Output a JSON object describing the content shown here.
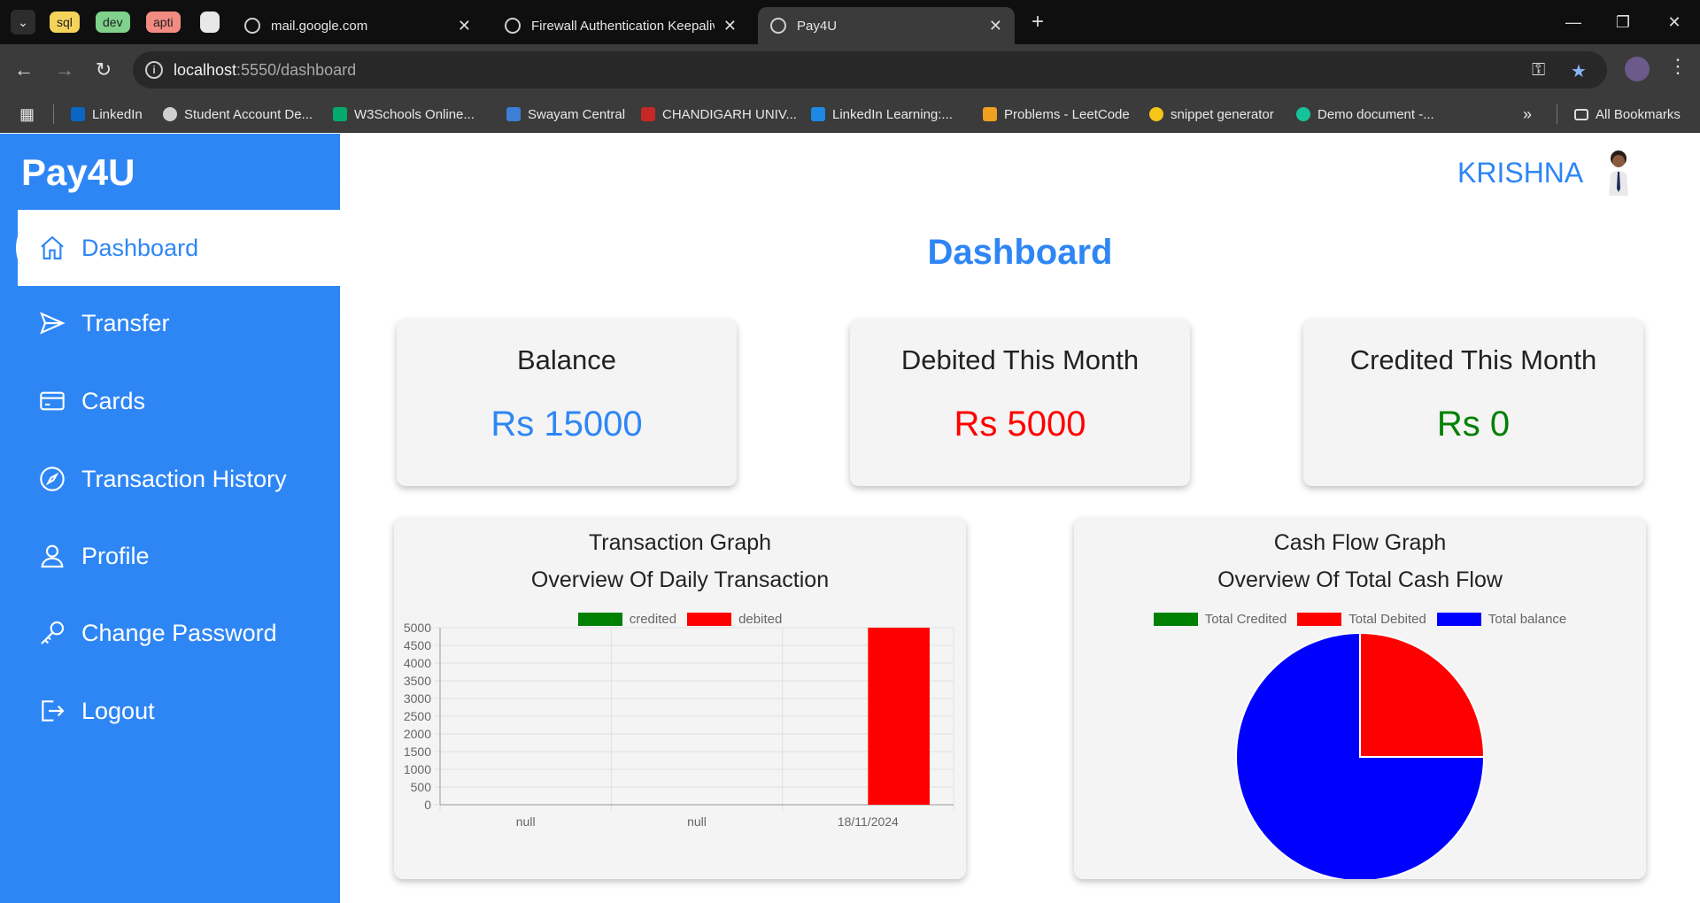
{
  "browser": {
    "tab_groups": [
      {
        "label": "sql",
        "color": "#f5d35b"
      },
      {
        "label": "dev",
        "color": "#7fd18b"
      },
      {
        "label": "apti",
        "color": "#f28b82"
      }
    ],
    "tabs": [
      {
        "title": "mail.google.com",
        "active": false
      },
      {
        "title": "Firewall Authentication Keepalive",
        "active": false
      },
      {
        "title": "Pay4U",
        "active": true
      }
    ],
    "url_host": "localhost",
    "url_path": ":5550/dashboard",
    "bookmarks": [
      {
        "label": "LinkedIn",
        "color": "#0a66c2"
      },
      {
        "label": "Student Account De...",
        "color": "#cfcfcf"
      },
      {
        "label": "W3Schools Online...",
        "color": "#04aa6d"
      },
      {
        "label": "Swayam Central",
        "color": "#3d7fd6"
      },
      {
        "label": "CHANDIGARH UNIV...",
        "color": "#c62828"
      },
      {
        "label": "LinkedIn Learning:...",
        "color": "#1e88e5"
      },
      {
        "label": "Problems - LeetCode",
        "color": "#f0a020"
      },
      {
        "label": "snippet generator",
        "color": "#f5c518"
      },
      {
        "label": "Demo document -...",
        "color": "#15c39a"
      }
    ],
    "all_bookmarks": "All Bookmarks"
  },
  "app": {
    "brand": "Pay4U",
    "user_name": "KRISHNA",
    "page_title": "Dashboard",
    "nav": [
      {
        "label": "Dashboard",
        "icon": "home-icon",
        "active": true
      },
      {
        "label": "Transfer",
        "icon": "send-icon",
        "active": false
      },
      {
        "label": "Cards",
        "icon": "credit-card-icon",
        "active": false
      },
      {
        "label": "Transaction History",
        "icon": "compass-icon",
        "active": false
      },
      {
        "label": "Profile",
        "icon": "user-icon",
        "active": false
      },
      {
        "label": "Change Password",
        "icon": "key-icon",
        "active": false
      },
      {
        "label": "Logout",
        "icon": "logout-icon",
        "active": false
      }
    ],
    "cards": [
      {
        "label": "Balance",
        "value": "Rs 15000",
        "color": "#2e86f5"
      },
      {
        "label": "Debited This Month",
        "value": "Rs 5000",
        "color": "#ff0000"
      },
      {
        "label": "Credited This Month",
        "value": "Rs 0",
        "color": "#008000"
      }
    ],
    "accent": "#2e86f5"
  },
  "chart_data": [
    {
      "type": "bar",
      "title": "Transaction Graph",
      "subtitle": "Overview Of Daily Transaction",
      "categories": [
        "null",
        "null",
        "18/11/2024"
      ],
      "series": [
        {
          "name": "credited",
          "color": "#008000",
          "values": [
            0,
            0,
            0
          ]
        },
        {
          "name": "debited",
          "color": "#ff0000",
          "values": [
            0,
            0,
            5000
          ]
        }
      ],
      "ylim": [
        0,
        5000
      ],
      "yticks": [
        0,
        500,
        1000,
        1500,
        2000,
        2500,
        3000,
        3500,
        4000,
        4500,
        5000
      ],
      "grid": true,
      "legend": "top"
    },
    {
      "type": "pie",
      "title": "Cash Flow Graph",
      "subtitle": "Overview Of Total Cash Flow",
      "labels": [
        "Total Credited",
        "Total Debited",
        "Total balance"
      ],
      "values": [
        0,
        5000,
        15000
      ],
      "colors": [
        "#008000",
        "#ff0000",
        "#0000ff"
      ],
      "legend": "top"
    }
  ]
}
